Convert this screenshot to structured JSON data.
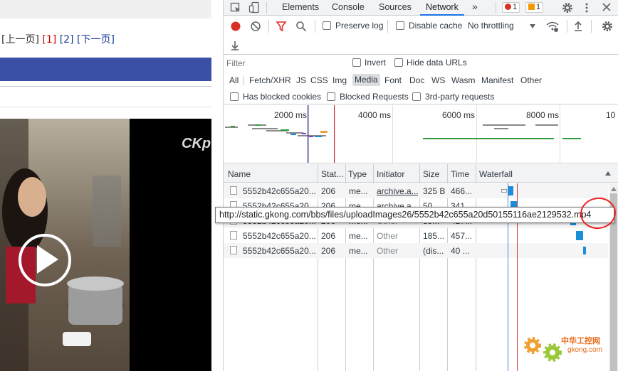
{
  "page": {
    "pager": {
      "prev": "[上一页]",
      "p1": "[1]",
      "p2": "[2]",
      "next": "[下一页]"
    },
    "video_watermark": "CKp"
  },
  "devtools": {
    "tabs": [
      "Elements",
      "Console",
      "Sources",
      "Network"
    ],
    "active_tab": "Network",
    "more_tabs": "»",
    "errors": "1",
    "warnings": "1",
    "toolbar": {
      "preserve_log": "Preserve log",
      "disable_cache": "Disable cache",
      "throttling": "No throttling"
    },
    "filter": {
      "placeholder": "Filter",
      "invert": "Invert",
      "hide_data_urls": "Hide data URLs"
    },
    "types": [
      "All",
      "Fetch/XHR",
      "JS",
      "CSS",
      "Img",
      "Media",
      "Font",
      "Doc",
      "WS",
      "Wasm",
      "Manifest",
      "Other"
    ],
    "selected_type": "Media",
    "blocked": {
      "has_blocked_cookies": "Has blocked cookies",
      "blocked_requests": "Blocked Requests",
      "third_party": "3rd-party requests"
    },
    "overview_ticks": [
      "2000 ms",
      "4000 ms",
      "6000 ms",
      "8000 ms",
      "10"
    ],
    "columns": [
      "Name",
      "Stat...",
      "Type",
      "Initiator",
      "Size",
      "Time",
      "Waterfall"
    ],
    "rows": [
      {
        "name": "5552b42c655a20...",
        "status": "206",
        "type": "me...",
        "initiator": "archive.a...",
        "size": "325 B",
        "time": "466..."
      },
      {
        "name": "5552b42c655a20...",
        "status": "206",
        "type": "me...",
        "initiator": "archive.a...",
        "size": "50...",
        "time": "341..."
      },
      {
        "name": "5552b42c655a20...",
        "status": "206",
        "type": "me...",
        "initiator": "Other",
        "size": "85...",
        "time": "427..."
      },
      {
        "name": "5552b42c655a20...",
        "status": "206",
        "type": "me...",
        "initiator": "Other",
        "size": "185...",
        "time": "457..."
      },
      {
        "name": "5552b42c655a20...",
        "status": "206",
        "type": "me...",
        "initiator": "Other",
        "size": "(dis...",
        "time": "40 ..."
      }
    ],
    "tooltip_url": "http://static.gkong.com/bbs/files/uploadImages26/5552b42c655a20d50155116ae2129532.mp4"
  },
  "logo": {
    "cn": "中华工控网",
    "en": "gkong.com"
  },
  "colors": {
    "accent": "#1a73e8",
    "page_blue_bar": "#3a4fa6",
    "waterfall": "#1a8fd8",
    "error": "#d93025"
  }
}
